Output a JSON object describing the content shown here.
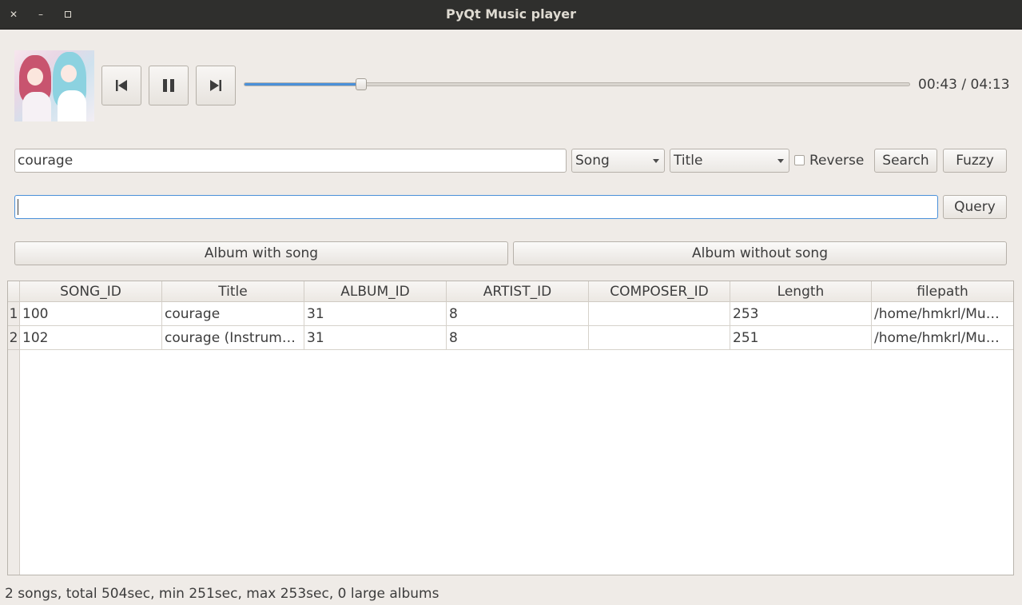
{
  "window": {
    "title": "PyQt Music player"
  },
  "player": {
    "prev_icon": "skip-previous-icon",
    "pause_icon": "pause-icon",
    "next_icon": "skip-next-icon",
    "progress_fraction": 0.176,
    "time_text": "00:43 / 04:13",
    "accent_color": "#4a90d9"
  },
  "search": {
    "query_value": "courage",
    "type_selected": "Song",
    "field_selected": "Title",
    "reverse_label": "Reverse",
    "reverse_checked": false,
    "search_label": "Search",
    "fuzzy_label": "Fuzzy"
  },
  "sql": {
    "input_value": "",
    "query_label": "Query"
  },
  "albums": {
    "with_song_label": "Album with song",
    "without_song_label": "Album without song"
  },
  "table": {
    "columns": [
      "SONG_ID",
      "Title",
      "ALBUM_ID",
      "ARTIST_ID",
      "COMPOSER_ID",
      "Length",
      "filepath"
    ],
    "rows": [
      {
        "num": "1",
        "cells": [
          "100",
          "courage",
          "31",
          "8",
          "",
          "253",
          "/home/hmkrl/Mu…"
        ]
      },
      {
        "num": "2",
        "cells": [
          "102",
          "courage (Instrum…",
          "31",
          "8",
          "",
          "251",
          "/home/hmkrl/Mu…"
        ]
      }
    ]
  },
  "status": {
    "text": "2 songs, total 504sec, min 251sec, max 253sec, 0 large albums"
  }
}
